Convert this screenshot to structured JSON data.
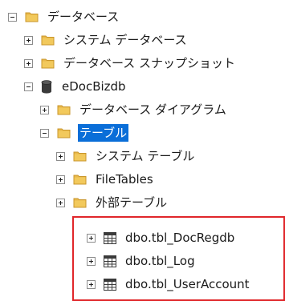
{
  "tree": {
    "root": {
      "label": "データベース",
      "expanded": true
    },
    "system_databases": {
      "label": "システム データベース",
      "expanded": false
    },
    "snapshots": {
      "label": "データベース スナップショット",
      "expanded": false
    },
    "database": {
      "label": "eDocBizdb",
      "expanded": true
    },
    "diagrams": {
      "label": "データベース ダイアグラム",
      "expanded": false
    },
    "tables": {
      "label": "テーブル",
      "expanded": true,
      "selected": true
    },
    "system_tables": {
      "label": "システム テーブル",
      "expanded": false
    },
    "file_tables": {
      "label": "FileTables",
      "expanded": false
    },
    "external_tables": {
      "label": "外部テーブル",
      "expanded": false
    },
    "table_items": [
      {
        "label": "dbo.tbl_DocRegdb"
      },
      {
        "label": "dbo.tbl_Log"
      },
      {
        "label": "dbo.tbl_UserAccount"
      }
    ]
  },
  "colors": {
    "folder": "#e8b84a",
    "selection": "#0a6ed8",
    "highlight_box": "#e0262a"
  },
  "icons": {
    "folder": "folder-icon",
    "database": "database-icon",
    "table": "table-icon",
    "expand": "plus-icon",
    "collapse": "minus-icon"
  }
}
